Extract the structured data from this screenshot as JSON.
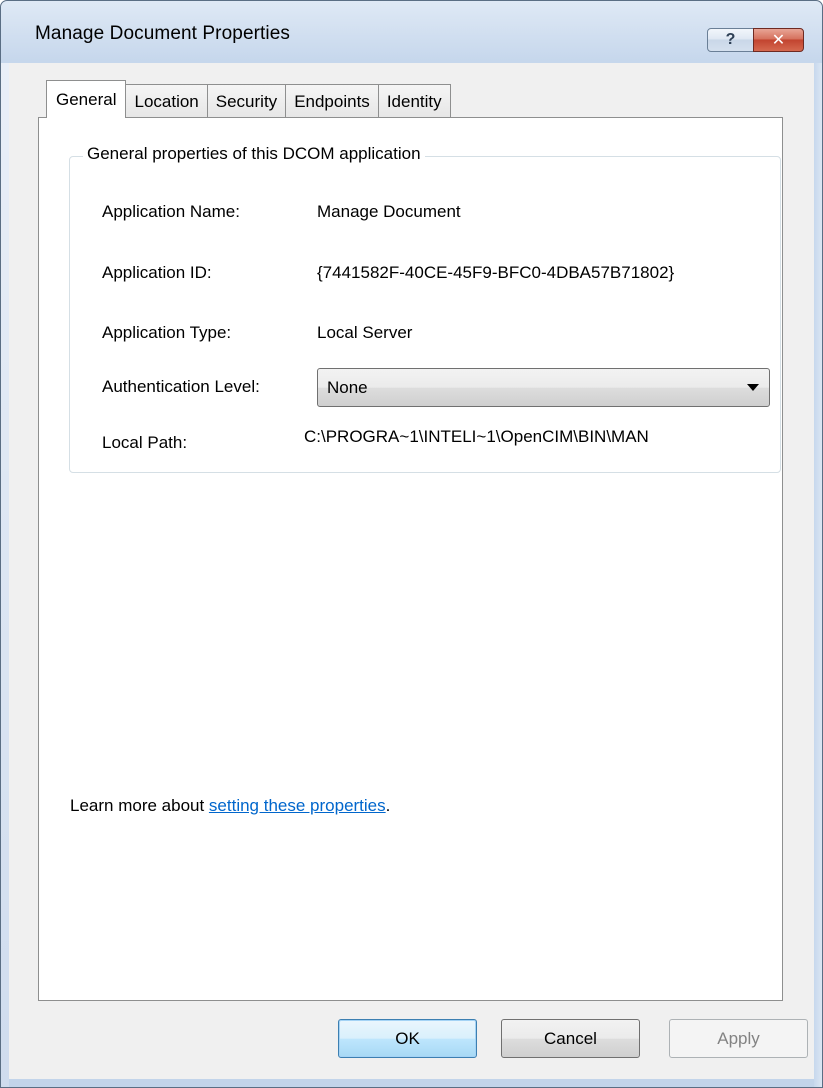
{
  "window": {
    "title": "Manage Document Properties",
    "help_glyph": "?",
    "close_glyph": "✕"
  },
  "tabs": [
    "General",
    "Location",
    "Security",
    "Endpoints",
    "Identity"
  ],
  "active_tab": "General",
  "group": {
    "title": "General properties of this DCOM application",
    "rows": {
      "app_name_label": "Application Name:",
      "app_name_value": "Manage Document",
      "app_id_label": "Application ID:",
      "app_id_value": "{7441582F-40CE-45F9-BFC0-4DBA57B71802}",
      "app_type_label": "Application Type:",
      "app_type_value": "Local Server",
      "auth_label": "Authentication Level:",
      "auth_value": "None",
      "path_label": "Local Path:",
      "path_value": "C:\\PROGRA~1\\INTELI~1\\OpenCIM\\BIN\\MAN"
    }
  },
  "learn_more": {
    "prefix": "Learn more about ",
    "link": "setting these properties",
    "suffix": "."
  },
  "buttons": {
    "ok": "OK",
    "cancel": "Cancel",
    "apply": "Apply"
  }
}
